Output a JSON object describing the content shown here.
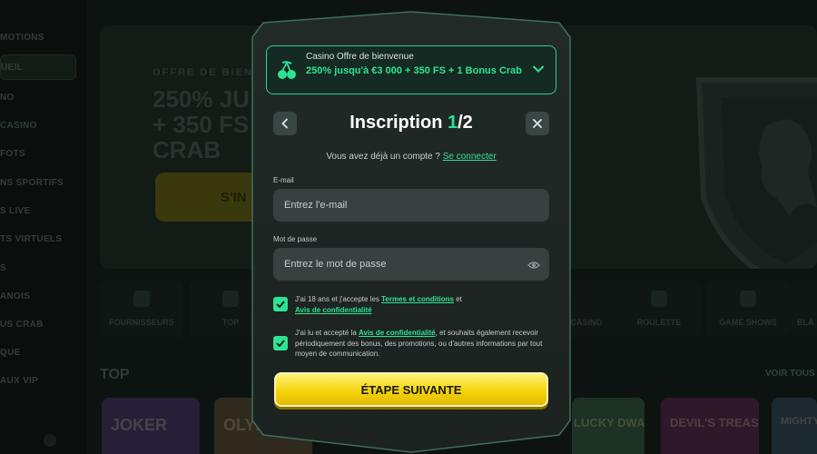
{
  "background": {
    "sidebar_items": [
      "MOTIONS",
      "UEIL",
      "NO",
      "CASINO",
      "FOTS",
      "NS SPORTIFS",
      "S LIVE",
      "TS VIRTUELS",
      "S",
      "ANOIS",
      "US CRAB",
      "QUE",
      "AUX VIP"
    ],
    "hero": {
      "eyebrow": "OFFRE DE BIENVE",
      "line1": "250% JU",
      "line2": "+ 350 FS",
      "line3": "CRAB",
      "cta": "S'IN"
    },
    "categories": [
      "FOURNISSEURS",
      "TOP",
      "",
      "",
      "",
      "",
      "CASINO",
      "ROULETTE",
      "GAME SHOWS",
      "BLA"
    ],
    "top_title": "TOP",
    "see_all": "VOIR TOUS",
    "games": [
      "JOKER",
      "OLYMP",
      "LUCKY DWARFS",
      "DEVIL'S TREASURE",
      "MIGHTY"
    ]
  },
  "modal": {
    "offer": {
      "pre": "Casino Offre de bienvenue",
      "main": "250% jusqu'à €3 000 + 350 FS + 1 Bonus Crab",
      "icon": "cherry-icon"
    },
    "title_text": "Inscription ",
    "step_current": "1",
    "step_total": "/2",
    "have_account": "Vous avez déjà un compte ? ",
    "login_link": "Se connecter",
    "email": {
      "label": "E-mail",
      "placeholder": "Entrez l'e-mail",
      "value": ""
    },
    "password": {
      "label": "Mot de passe",
      "placeholder": "Entrez le mot de passe",
      "value": ""
    },
    "terms1": {
      "checked": true,
      "pre": "J'ai 18 ans et j'accepte les ",
      "link1": "Termes et conditions",
      "mid": " et ",
      "link2": "Avis de confidentialité"
    },
    "terms2": {
      "checked": true,
      "pre": "J'ai lu et accepté la ",
      "link": "Avis de confidentialité",
      "post": ", et souhaits également recevoir périodiquement des bonus, des promotions, ou d'autres informations par tout moyen de communication."
    },
    "next_button": "ÉTAPE SUIVANTE",
    "colors": {
      "accent": "#2ee294",
      "cta": "#f4d40a",
      "panel": "#1f2725"
    }
  }
}
